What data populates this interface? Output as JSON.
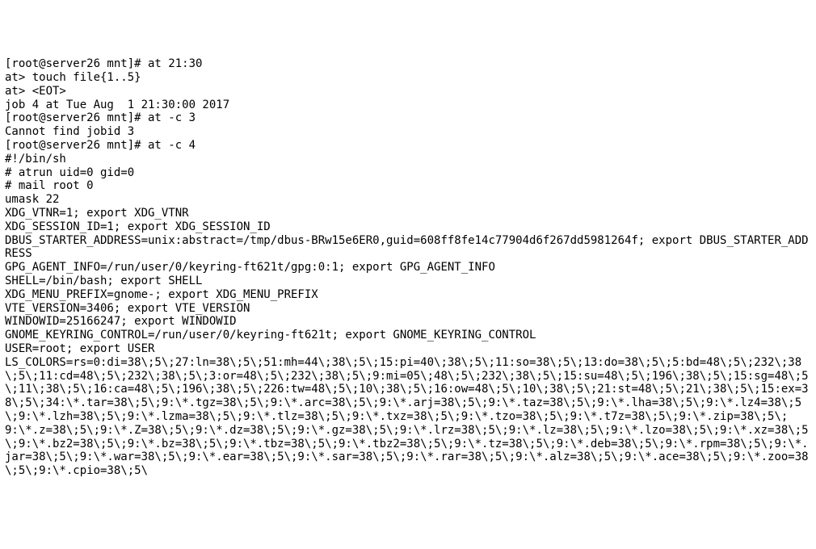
{
  "terminal": {
    "lines": [
      "[root@server26 mnt]# at 21:30",
      "at> touch file{1..5}",
      "at> <EOT>",
      "job 4 at Tue Aug  1 21:30:00 2017",
      "[root@server26 mnt]# at -c 3",
      "Cannot find jobid 3",
      "[root@server26 mnt]# at -c 4",
      "#!/bin/sh",
      "# atrun uid=0 gid=0",
      "# mail root 0",
      "umask 22",
      "XDG_VTNR=1; export XDG_VTNR",
      "XDG_SESSION_ID=1; export XDG_SESSION_ID",
      "DBUS_STARTER_ADDRESS=unix:abstract=/tmp/dbus-BRw15e6ER0,guid=608ff8fe14c77904d6f267dd5981264f; export DBUS_STARTER_ADDRESS",
      "GPG_AGENT_INFO=/run/user/0/keyring-ft621t/gpg:0:1; export GPG_AGENT_INFO",
      "SHELL=/bin/bash; export SHELL",
      "XDG_MENU_PREFIX=gnome-; export XDG_MENU_PREFIX",
      "VTE_VERSION=3406; export VTE_VERSION",
      "WINDOWID=25166247; export WINDOWID",
      "GNOME_KEYRING_CONTROL=/run/user/0/keyring-ft621t; export GNOME_KEYRING_CONTROL",
      "USER=root; export USER",
      "LS_COLORS=rs=0:di=38\\;5\\;27:ln=38\\;5\\;51:mh=44\\;38\\;5\\;15:pi=40\\;38\\;5\\;11:so=38\\;5\\;13:do=38\\;5\\;5:bd=48\\;5\\;232\\;38\\;5\\;11:cd=48\\;5\\;232\\;38\\;5\\;3:or=48\\;5\\;232\\;38\\;5\\;9:mi=05\\;48\\;5\\;232\\;38\\;5\\;15:su=48\\;5\\;196\\;38\\;5\\;15:sg=48\\;5\\;11\\;38\\;5\\;16:ca=48\\;5\\;196\\;38\\;5\\;226:tw=48\\;5\\;10\\;38\\;5\\;16:ow=48\\;5\\;10\\;38\\;5\\;21:st=48\\;5\\;21\\;38\\;5\\;15:ex=38\\;5\\;34:\\*.tar=38\\;5\\;9:\\*.tgz=38\\;5\\;9:\\*.arc=38\\;5\\;9:\\*.arj=38\\;5\\;9:\\*.taz=38\\;5\\;9:\\*.lha=38\\;5\\;9:\\*.lz4=38\\;5\\;9:\\*.lzh=38\\;5\\;9:\\*.lzma=38\\;5\\;9:\\*.tlz=38\\;5\\;9:\\*.txz=38\\;5\\;9:\\*.tzo=38\\;5\\;9:\\*.t7z=38\\;5\\;9:\\*.zip=38\\;5\\;9:\\*.z=38\\;5\\;9:\\*.Z=38\\;5\\;9:\\*.dz=38\\;5\\;9:\\*.gz=38\\;5\\;9:\\*.lrz=38\\;5\\;9:\\*.lz=38\\;5\\;9:\\*.lzo=38\\;5\\;9:\\*.xz=38\\;5\\;9:\\*.bz2=38\\;5\\;9:\\*.bz=38\\;5\\;9:\\*.tbz=38\\;5\\;9:\\*.tbz2=38\\;5\\;9:\\*.tz=38\\;5\\;9:\\*.deb=38\\;5\\;9:\\*.rpm=38\\;5\\;9:\\*.jar=38\\;5\\;9:\\*.war=38\\;5\\;9:\\*.ear=38\\;5\\;9:\\*.sar=38\\;5\\;9:\\*.rar=38\\;5\\;9:\\*.alz=38\\;5\\;9:\\*.ace=38\\;5\\;9:\\*.zoo=38\\;5\\;9:\\*.cpio=38\\;5\\"
    ]
  }
}
